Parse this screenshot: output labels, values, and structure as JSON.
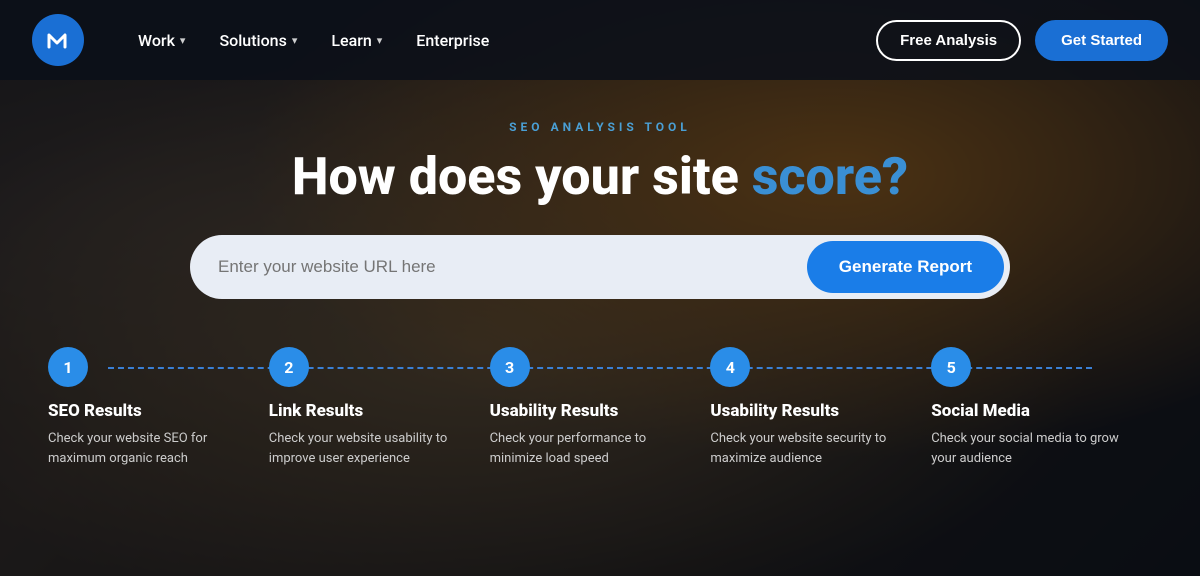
{
  "brand": {
    "logo_alt": "Mantra Logo"
  },
  "nav": {
    "work_label": "Work",
    "solutions_label": "Solutions",
    "learn_label": "Learn",
    "enterprise_label": "Enterprise",
    "free_analysis_label": "Free Analysis",
    "get_started_label": "Get Started"
  },
  "hero": {
    "subtitle": "SEO ANALYSIS TOOL",
    "title_part1": "How does your site ",
    "title_part2": "score?",
    "url_placeholder": "Enter your website URL here",
    "generate_label": "Generate Report"
  },
  "steps": [
    {
      "number": "1",
      "title": "SEO Results",
      "desc": "Check your website SEO for maximum organic reach"
    },
    {
      "number": "2",
      "title": "Link Results",
      "desc": "Check your website usability to improve user experience"
    },
    {
      "number": "3",
      "title": "Usability Results",
      "desc": "Check your performance to minimize load speed"
    },
    {
      "number": "4",
      "title": "Usability Results",
      "desc": "Check your website security to maximize audience"
    },
    {
      "number": "5",
      "title": "Social Media",
      "desc": "Check your social media to grow your audience"
    }
  ]
}
